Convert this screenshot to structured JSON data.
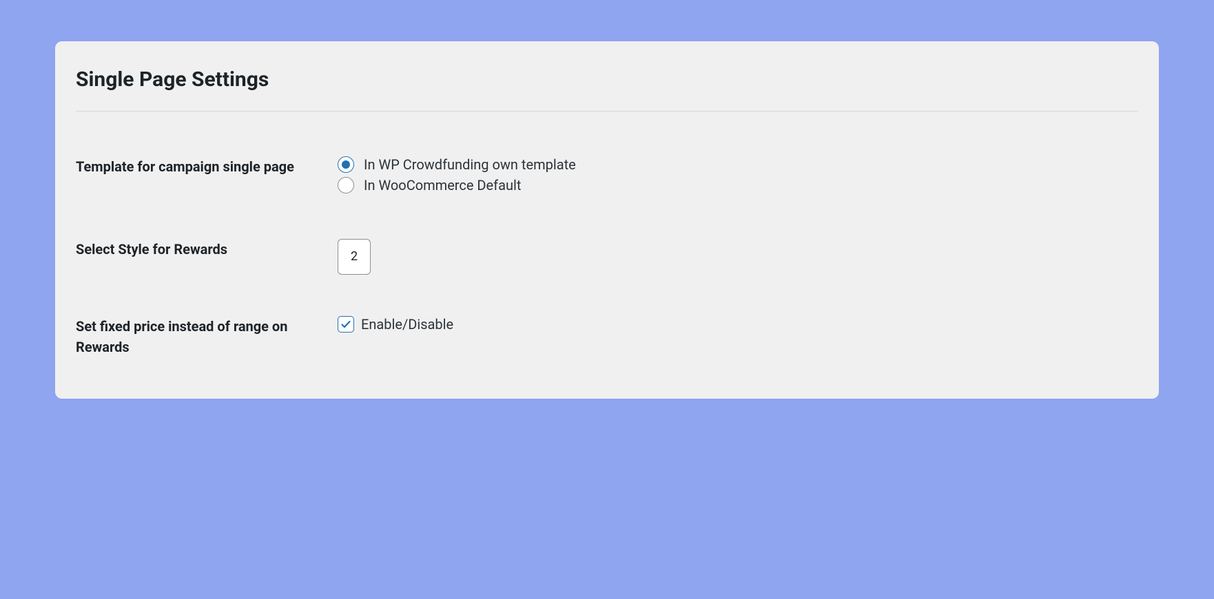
{
  "panel": {
    "title": "Single Page Settings",
    "fields": {
      "template": {
        "label": "Template for campaign single page",
        "options": [
          {
            "label": "In WP Crowdfunding own template",
            "selected": true
          },
          {
            "label": "In WooCommerce Default",
            "selected": false
          }
        ]
      },
      "rewards_style": {
        "label": "Select Style for Rewards",
        "selected_value": "2"
      },
      "fixed_price": {
        "label": "Set fixed price instead of range on Rewards",
        "checkbox_label": "Enable/Disable",
        "checked": true
      }
    }
  }
}
